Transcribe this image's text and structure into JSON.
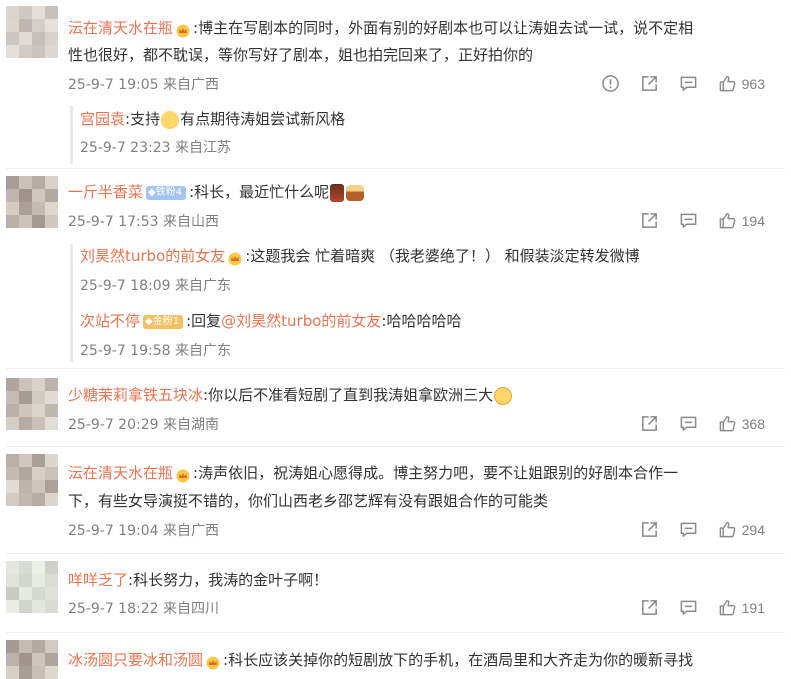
{
  "comments": [
    {
      "user": "沄在清天水在瓶",
      "text_lines": [
        ":博主在写剧本的同时，外面有别的好剧本也可以让涛姐去试一试，说不定相",
        "性也很好，都不耽误，等你写好了剧本，姐也拍完回来了，正好拍你的"
      ],
      "time": "25-9-7 19:05",
      "location": "来自广西",
      "likes": "963",
      "avatar_colors": [
        "#d9d4d0",
        "#cfc9c4",
        "#e2ddd8",
        "#c8c0ba",
        "#dcd6d0",
        "#bfb6af",
        "#d5cec8",
        "#e6e1dc",
        "#cec7c1",
        "#e0dad5",
        "#c6beb8",
        "#d8d2cc",
        "#e4dfda",
        "#d2cbc5",
        "#cbc3bd",
        "#ddd7d1"
      ],
      "replies": [
        {
          "user": "宫园袁",
          "text": ":支持",
          "text_after": "有点期待涛姐尝试新风格",
          "time": "25-9-7 23:23",
          "location": "来自江苏"
        }
      ]
    },
    {
      "user": "一斤半香菜",
      "tag": "铁粉4",
      "text": ":科长，最近忙什么呢",
      "time": "25-9-7 17:53",
      "location": "来自山西",
      "likes": "194",
      "avatar_colors": [
        "#a89e95",
        "#c9c1ba",
        "#b5aca4",
        "#d8d1cb",
        "#bfb6ae",
        "#9e948b",
        "#cfc7c0",
        "#b2a9a1",
        "#d4cdc6",
        "#aaa097",
        "#c4bbb3",
        "#dcd6d0",
        "#b8afa7",
        "#cbc3bc",
        "#a49a91",
        "#d0c9c2"
      ],
      "replies": [
        {
          "user": "刘昊然turbo的前女友",
          "text": ":这题我会 忙着暗爽 （我老婆绝了！） 和假装淡定转发微博",
          "time": "25-9-7 18:09",
          "location": "来自广东"
        },
        {
          "user": "次站不停",
          "tag": "金粉1",
          "text_prefix": ":回复",
          "mention": "@刘昊然turbo的前女友",
          "text": ":哈哈哈哈哈",
          "time": "25-9-7 19:58",
          "location": "来自广东"
        }
      ]
    },
    {
      "user": "少糖茉莉拿铁五块冰",
      "text": ":你以后不准看短剧了直到我涛姐拿欧洲三大",
      "time": "25-9-7 20:29",
      "location": "来自湖南",
      "likes": "368",
      "avatar_colors": [
        "#b0a69d",
        "#cac2bb",
        "#d9d3cd",
        "#bcb3ab",
        "#c5bcb4",
        "#a69c93",
        "#d2cbc4",
        "#e0dbd6",
        "#b9b0a8",
        "#cec6bf",
        "#dad4ce",
        "#c0b7af",
        "#d5cec7",
        "#b4aba3",
        "#c9c0b8",
        "#e2ddd8"
      ]
    },
    {
      "user": "沄在清天水在瓶",
      "text_lines": [
        ":涛声依旧，祝涛姐心愿得成。博主努力吧，要不让姐跟别的好剧本合作一",
        "下，有些女导演挺不错的，你们山西老乡邵艺辉有没有跟姐合作的可能类"
      ],
      "time": "25-9-7 19:04",
      "location": "来自广西",
      "likes": "294",
      "avatar_colors": [
        "#b9b0a9",
        "#cfc8c2",
        "#a99f97",
        "#dcd6d0",
        "#c3bab3",
        "#b0a7a0",
        "#d6cfc9",
        "#c9c1ba",
        "#e0dbd6",
        "#bdb4ad",
        "#cdc5be",
        "#aba199",
        "#d3ccc5",
        "#c1b8b1",
        "#b6ada6",
        "#dad4ce"
      ]
    },
    {
      "user": "咩咩乏了",
      "text": ":科长努力，我涛的金叶子啊！",
      "time": "25-9-7 18:22",
      "location": "来自四川",
      "likes": "191",
      "avatar_colors": [
        "#e4e6e0",
        "#d8dbd4",
        "#eceee8",
        "#cfd2cb",
        "#e0e3dc",
        "#d3d6cf",
        "#e8eae4",
        "#dadcd6",
        "#c9ccc5",
        "#e6e8e2",
        "#d6d9d2",
        "#dfe1db",
        "#eaece6",
        "#d1d4cd",
        "#e3e5df",
        "#d9dcd5"
      ]
    },
    {
      "user": "冰汤圆只要冰和汤圆",
      "text": ":科长应该关掉你的短剧放下的手机，在酒局里和大齐走为你的暖新寻找",
      "avatar_colors": [
        "#a59b93",
        "#c3bbb4",
        "#b3aaa2",
        "#d2cbc4",
        "#bbb2aa",
        "#9f958c",
        "#cdc5be",
        "#aea59d",
        "#d6d0ca",
        "#a89e96",
        "#c7bfb8",
        "#ddd8d2",
        "#b7aea6",
        "#c9c1ba",
        "#a3998f",
        "#d0c9c2"
      ]
    }
  ],
  "colors": {
    "username": "#eb7350",
    "meta": "#808080",
    "icon": "#8a8a8a"
  },
  "icons": [
    "report-icon",
    "share-icon",
    "comment-icon",
    "like-icon"
  ]
}
